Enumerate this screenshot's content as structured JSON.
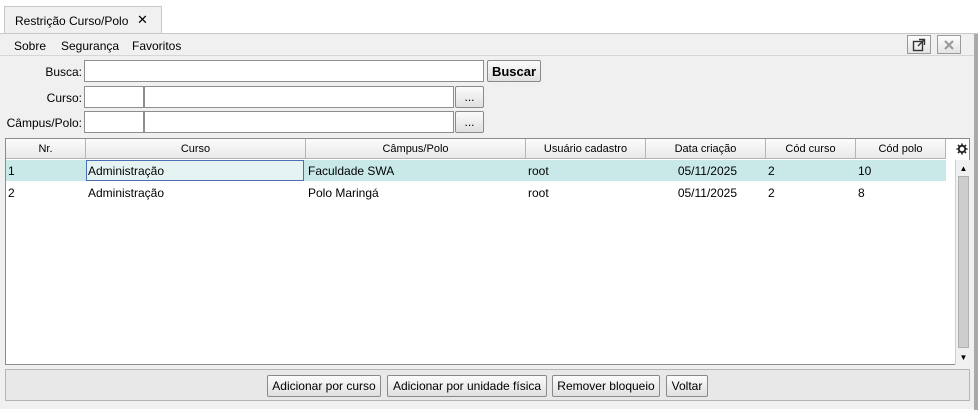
{
  "tab": {
    "title": "Restrição Curso/Polo",
    "close": "✕"
  },
  "menu": {
    "items": [
      "Sobre",
      "Segurança",
      "Favoritos"
    ]
  },
  "window_buttons": {
    "popout": "⧉",
    "close": "✕"
  },
  "form": {
    "busca_label": "Busca:",
    "busca_value": "",
    "buscar_button": "Buscar",
    "curso_label": "Curso:",
    "campus_label": "Câmpus/Polo:",
    "browse_button": "..."
  },
  "table": {
    "columns": [
      "Nr.",
      "Curso",
      "Câmpus/Polo",
      "Usuário cadastro",
      "Data criação",
      "Cód curso",
      "Cód polo"
    ],
    "rows": [
      [
        "1",
        "Administração",
        "Faculdade SWA",
        "root",
        "05/11/2025",
        "2",
        "10"
      ],
      [
        "2",
        "Administração",
        "Polo Maringá",
        "root",
        "05/11/2025",
        "2",
        "8"
      ]
    ],
    "settings_icon": "gear-icon",
    "selected_row_color": "#c9e9e9"
  },
  "actions": {
    "add_course": "Adicionar por curso",
    "add_unit": "Adicionar por unidade física",
    "remove_block": "Remover bloqueio",
    "back": "Voltar"
  }
}
